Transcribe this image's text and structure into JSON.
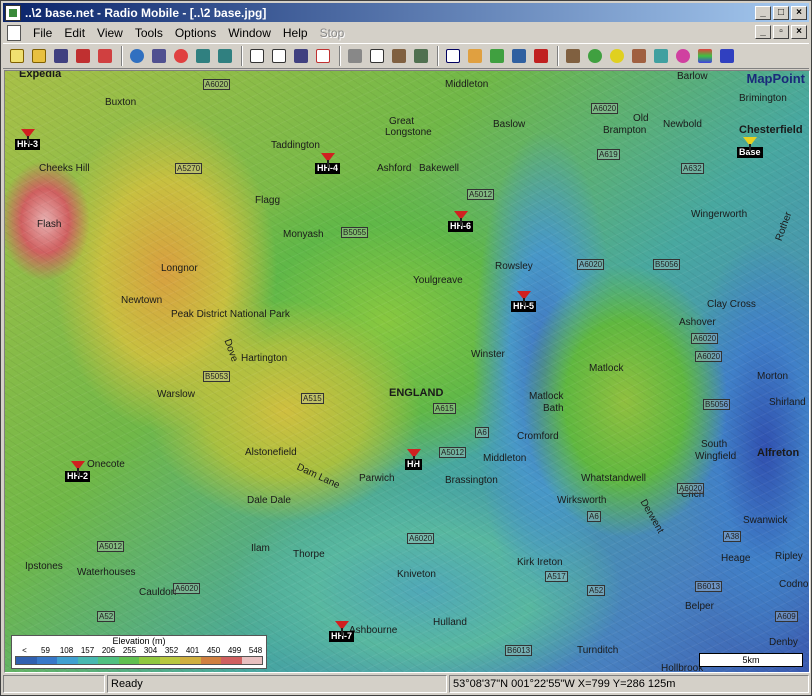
{
  "window": {
    "title": "..\\2 base.net - Radio Mobile - [..\\2 base.jpg]",
    "controls": [
      "_",
      "□",
      "×"
    ]
  },
  "menu": {
    "items": [
      "File",
      "Edit",
      "View",
      "Tools",
      "Options",
      "Window",
      "Help",
      "Stop"
    ],
    "mdi_controls": [
      "_",
      "▫",
      "×"
    ]
  },
  "map": {
    "brand": "MapPoint",
    "places": [
      {
        "name": "Buxton",
        "bold": false
      },
      {
        "name": "Barlow",
        "bold": false
      },
      {
        "name": "Brimington",
        "bold": false
      },
      {
        "name": "Chesterfield",
        "bold": true
      },
      {
        "name": "Middleton",
        "bold": false
      },
      {
        "name": "Great",
        "bold": false
      },
      {
        "name": "Longstone",
        "bold": false
      },
      {
        "name": "Baslow",
        "bold": false
      },
      {
        "name": "Old",
        "bold": false
      },
      {
        "name": "Brampton",
        "bold": false
      },
      {
        "name": "Newbold",
        "bold": false
      },
      {
        "name": "Taddington",
        "bold": false
      },
      {
        "name": "Cheeks Hill",
        "bold": false
      },
      {
        "name": "Ashford",
        "bold": false
      },
      {
        "name": "Bakewell",
        "bold": false
      },
      {
        "name": "Flagg",
        "bold": false
      },
      {
        "name": "Wingerworth",
        "bold": false
      },
      {
        "name": "Flash",
        "bold": false
      },
      {
        "name": "Monyash",
        "bold": false
      },
      {
        "name": "Rowsley",
        "bold": false
      },
      {
        "name": "Longnor",
        "bold": false
      },
      {
        "name": "Youlgreave",
        "bold": false
      },
      {
        "name": "Newtown",
        "bold": false
      },
      {
        "name": "Clay Cross",
        "bold": false
      },
      {
        "name": "Peak District National Park",
        "bold": false
      },
      {
        "name": "Ashover",
        "bold": false
      },
      {
        "name": "Hartington",
        "bold": false
      },
      {
        "name": "Winster",
        "bold": false
      },
      {
        "name": "Matlock",
        "bold": false
      },
      {
        "name": "Morton",
        "bold": false
      },
      {
        "name": "Warslow",
        "bold": false
      },
      {
        "name": "ENGLAND",
        "bold": true
      },
      {
        "name": "Matlock",
        "bold": false
      },
      {
        "name": "Bath",
        "bold": false
      },
      {
        "name": "Shirland",
        "bold": false
      },
      {
        "name": "Cromford",
        "bold": false
      },
      {
        "name": "Alstonefield",
        "bold": false
      },
      {
        "name": "South",
        "bold": false
      },
      {
        "name": "Wingfield",
        "bold": false
      },
      {
        "name": "Alfreton",
        "bold": true
      },
      {
        "name": "Onecote",
        "bold": false
      },
      {
        "name": "Middleton",
        "bold": false
      },
      {
        "name": "Parwich",
        "bold": false
      },
      {
        "name": "Brassington",
        "bold": false
      },
      {
        "name": "Whatstandwell",
        "bold": false
      },
      {
        "name": "Dam Lane",
        "bold": false
      },
      {
        "name": "Crich",
        "bold": false
      },
      {
        "name": "Dale Dale",
        "bold": false
      },
      {
        "name": "Wirksworth",
        "bold": false
      },
      {
        "name": "Swanwick",
        "bold": false
      },
      {
        "name": "Ilam",
        "bold": false
      },
      {
        "name": "Thorpe",
        "bold": false
      },
      {
        "name": "Heage",
        "bold": false
      },
      {
        "name": "Ripley",
        "bold": false
      },
      {
        "name": "Ipstones",
        "bold": false
      },
      {
        "name": "Waterhouses",
        "bold": false
      },
      {
        "name": "Kniveton",
        "bold": false
      },
      {
        "name": "Kirk Ireton",
        "bold": false
      },
      {
        "name": "Codnor",
        "bold": false
      },
      {
        "name": "Cauldon",
        "bold": false
      },
      {
        "name": "Belper",
        "bold": false
      },
      {
        "name": "Hulland",
        "bold": false
      },
      {
        "name": "Ashbourne",
        "bold": false
      },
      {
        "name": "Turnditch",
        "bold": false
      },
      {
        "name": "Denby",
        "bold": false
      },
      {
        "name": "Hollbrook",
        "bold": false
      },
      {
        "name": "Expedia",
        "bold": true
      },
      {
        "name": "Rother",
        "bold": false
      },
      {
        "name": "Derwent",
        "bold": false
      },
      {
        "name": "Dove",
        "bold": false
      }
    ],
    "roads": [
      "A6020",
      "A5270",
      "A6020",
      "A619",
      "A632",
      "A5012",
      "B5055",
      "A6020",
      "B5056",
      "A6020",
      "A515",
      "B5053",
      "A615",
      "A6",
      "A6020",
      "B5056",
      "A5012",
      "A5012",
      "A52",
      "A517",
      "B6013",
      "A6020",
      "A6",
      "A52",
      "A38",
      "B6013",
      "A6020",
      "A6020",
      "A609"
    ],
    "stations": [
      "HH-3",
      "HH-4",
      "HH-6",
      "HH-5",
      "Base",
      "HH",
      "HH-2",
      "HH-7"
    ],
    "legend": {
      "title": "Elevation (m)",
      "labels": [
        "<",
        "59",
        "108",
        "157",
        "206",
        "255",
        "304",
        "352",
        "401",
        "450",
        "499",
        "548"
      ],
      "colors": [
        "#3060b0",
        "#3878c8",
        "#40a0d0",
        "#48b8b0",
        "#50c080",
        "#60c050",
        "#90c840",
        "#b8c840",
        "#d0b040",
        "#d08040",
        "#d06060",
        "#e8c0c0"
      ]
    },
    "scale": "5km"
  },
  "status": {
    "panel1": "",
    "message": "Ready",
    "coords": "53°08'37\"N 001°22'55\"W  X=799 Y=286 125m"
  }
}
